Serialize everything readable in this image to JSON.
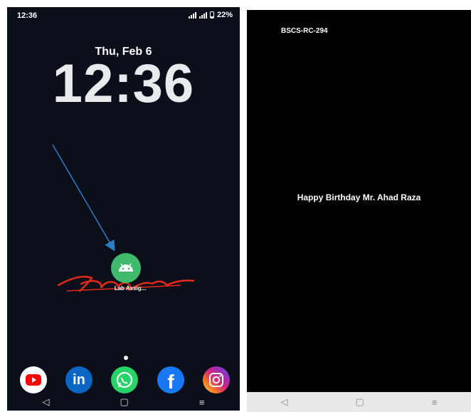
{
  "left_phone": {
    "status_bar": {
      "time": "12:36",
      "battery": "22%"
    },
    "lock": {
      "date": "Thu, Feb 6",
      "time": "12:36"
    },
    "home": {
      "app_label": "Lab Assig..."
    },
    "dock": [
      "youtube-icon",
      "linkedin-icon",
      "whatsapp-icon",
      "facebook-icon",
      "instagram-icon"
    ],
    "linkedin_text": "in",
    "facebook_text": "f",
    "nav": {
      "back": "◁",
      "home": "▢",
      "menu": "≡"
    }
  },
  "right_phone": {
    "title": "BSCS-RC-294",
    "message": "Happy Birthday Mr. Ahad Raza",
    "nav": {
      "back": "◁",
      "home": "▢",
      "menu": "≡"
    }
  },
  "colors": {
    "left_bg": "#0b0f1a",
    "right_bg": "#000000",
    "app_icon": "#3fb96b",
    "signature_red": "#e4281b",
    "arrow_blue": "#2a7fc4"
  }
}
